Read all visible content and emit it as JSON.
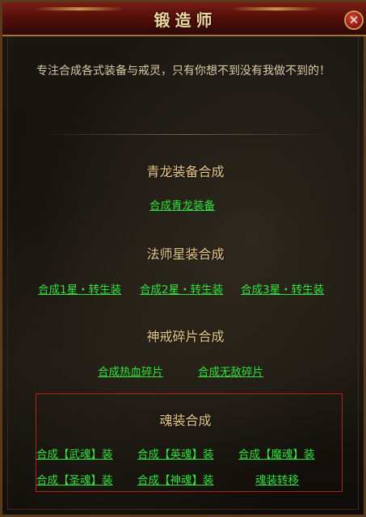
{
  "window": {
    "title": "锻造师",
    "close_icon": "close-x-icon"
  },
  "intro": {
    "text": "专注合成各式装备与戒灵，只有你想不到没有我做不到的！"
  },
  "sections": {
    "qinglong": {
      "title": "青龙装备合成",
      "links": [
        "合成青龙装备"
      ]
    },
    "mage_star": {
      "title": "法师星装合成",
      "links": [
        "合成1星・转生装",
        "合成2星・转生装",
        "合成3星・转生装"
      ]
    },
    "ring_fragment": {
      "title": "神戒碎片合成",
      "links": [
        "合成热血碎片",
        "合成无敌碎片"
      ]
    },
    "soul_gear": {
      "title": "魂装合成",
      "links": [
        "合成【武魂】装",
        "合成【英魂】装",
        "合成【魔魂】装",
        "合成【圣魂】装",
        "合成【神魂】装",
        "魂装转移"
      ]
    }
  },
  "colors": {
    "link": "#2fe33a",
    "title": "#e9c88a",
    "highlight_box": "#b5201a"
  }
}
